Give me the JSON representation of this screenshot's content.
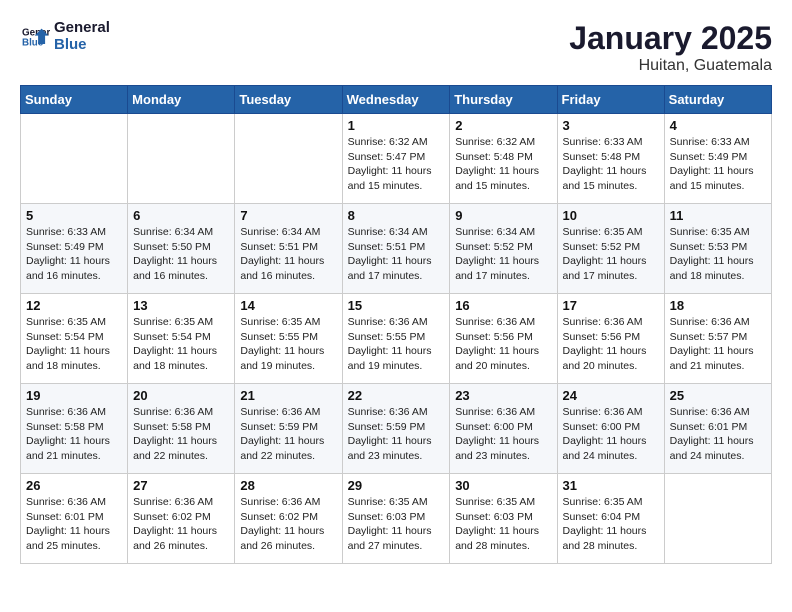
{
  "header": {
    "logo_line1": "General",
    "logo_line2": "Blue",
    "month_title": "January 2025",
    "location": "Huitan, Guatemala"
  },
  "weekdays": [
    "Sunday",
    "Monday",
    "Tuesday",
    "Wednesday",
    "Thursday",
    "Friday",
    "Saturday"
  ],
  "weeks": [
    [
      {
        "day": "",
        "info": ""
      },
      {
        "day": "",
        "info": ""
      },
      {
        "day": "",
        "info": ""
      },
      {
        "day": "1",
        "info": "Sunrise: 6:32 AM\nSunset: 5:47 PM\nDaylight: 11 hours\nand 15 minutes."
      },
      {
        "day": "2",
        "info": "Sunrise: 6:32 AM\nSunset: 5:48 PM\nDaylight: 11 hours\nand 15 minutes."
      },
      {
        "day": "3",
        "info": "Sunrise: 6:33 AM\nSunset: 5:48 PM\nDaylight: 11 hours\nand 15 minutes."
      },
      {
        "day": "4",
        "info": "Sunrise: 6:33 AM\nSunset: 5:49 PM\nDaylight: 11 hours\nand 15 minutes."
      }
    ],
    [
      {
        "day": "5",
        "info": "Sunrise: 6:33 AM\nSunset: 5:49 PM\nDaylight: 11 hours\nand 16 minutes."
      },
      {
        "day": "6",
        "info": "Sunrise: 6:34 AM\nSunset: 5:50 PM\nDaylight: 11 hours\nand 16 minutes."
      },
      {
        "day": "7",
        "info": "Sunrise: 6:34 AM\nSunset: 5:51 PM\nDaylight: 11 hours\nand 16 minutes."
      },
      {
        "day": "8",
        "info": "Sunrise: 6:34 AM\nSunset: 5:51 PM\nDaylight: 11 hours\nand 17 minutes."
      },
      {
        "day": "9",
        "info": "Sunrise: 6:34 AM\nSunset: 5:52 PM\nDaylight: 11 hours\nand 17 minutes."
      },
      {
        "day": "10",
        "info": "Sunrise: 6:35 AM\nSunset: 5:52 PM\nDaylight: 11 hours\nand 17 minutes."
      },
      {
        "day": "11",
        "info": "Sunrise: 6:35 AM\nSunset: 5:53 PM\nDaylight: 11 hours\nand 18 minutes."
      }
    ],
    [
      {
        "day": "12",
        "info": "Sunrise: 6:35 AM\nSunset: 5:54 PM\nDaylight: 11 hours\nand 18 minutes."
      },
      {
        "day": "13",
        "info": "Sunrise: 6:35 AM\nSunset: 5:54 PM\nDaylight: 11 hours\nand 18 minutes."
      },
      {
        "day": "14",
        "info": "Sunrise: 6:35 AM\nSunset: 5:55 PM\nDaylight: 11 hours\nand 19 minutes."
      },
      {
        "day": "15",
        "info": "Sunrise: 6:36 AM\nSunset: 5:55 PM\nDaylight: 11 hours\nand 19 minutes."
      },
      {
        "day": "16",
        "info": "Sunrise: 6:36 AM\nSunset: 5:56 PM\nDaylight: 11 hours\nand 20 minutes."
      },
      {
        "day": "17",
        "info": "Sunrise: 6:36 AM\nSunset: 5:56 PM\nDaylight: 11 hours\nand 20 minutes."
      },
      {
        "day": "18",
        "info": "Sunrise: 6:36 AM\nSunset: 5:57 PM\nDaylight: 11 hours\nand 21 minutes."
      }
    ],
    [
      {
        "day": "19",
        "info": "Sunrise: 6:36 AM\nSunset: 5:58 PM\nDaylight: 11 hours\nand 21 minutes."
      },
      {
        "day": "20",
        "info": "Sunrise: 6:36 AM\nSunset: 5:58 PM\nDaylight: 11 hours\nand 22 minutes."
      },
      {
        "day": "21",
        "info": "Sunrise: 6:36 AM\nSunset: 5:59 PM\nDaylight: 11 hours\nand 22 minutes."
      },
      {
        "day": "22",
        "info": "Sunrise: 6:36 AM\nSunset: 5:59 PM\nDaylight: 11 hours\nand 23 minutes."
      },
      {
        "day": "23",
        "info": "Sunrise: 6:36 AM\nSunset: 6:00 PM\nDaylight: 11 hours\nand 23 minutes."
      },
      {
        "day": "24",
        "info": "Sunrise: 6:36 AM\nSunset: 6:00 PM\nDaylight: 11 hours\nand 24 minutes."
      },
      {
        "day": "25",
        "info": "Sunrise: 6:36 AM\nSunset: 6:01 PM\nDaylight: 11 hours\nand 24 minutes."
      }
    ],
    [
      {
        "day": "26",
        "info": "Sunrise: 6:36 AM\nSunset: 6:01 PM\nDaylight: 11 hours\nand 25 minutes."
      },
      {
        "day": "27",
        "info": "Sunrise: 6:36 AM\nSunset: 6:02 PM\nDaylight: 11 hours\nand 26 minutes."
      },
      {
        "day": "28",
        "info": "Sunrise: 6:36 AM\nSunset: 6:02 PM\nDaylight: 11 hours\nand 26 minutes."
      },
      {
        "day": "29",
        "info": "Sunrise: 6:35 AM\nSunset: 6:03 PM\nDaylight: 11 hours\nand 27 minutes."
      },
      {
        "day": "30",
        "info": "Sunrise: 6:35 AM\nSunset: 6:03 PM\nDaylight: 11 hours\nand 28 minutes."
      },
      {
        "day": "31",
        "info": "Sunrise: 6:35 AM\nSunset: 6:04 PM\nDaylight: 11 hours\nand 28 minutes."
      },
      {
        "day": "",
        "info": ""
      }
    ]
  ]
}
